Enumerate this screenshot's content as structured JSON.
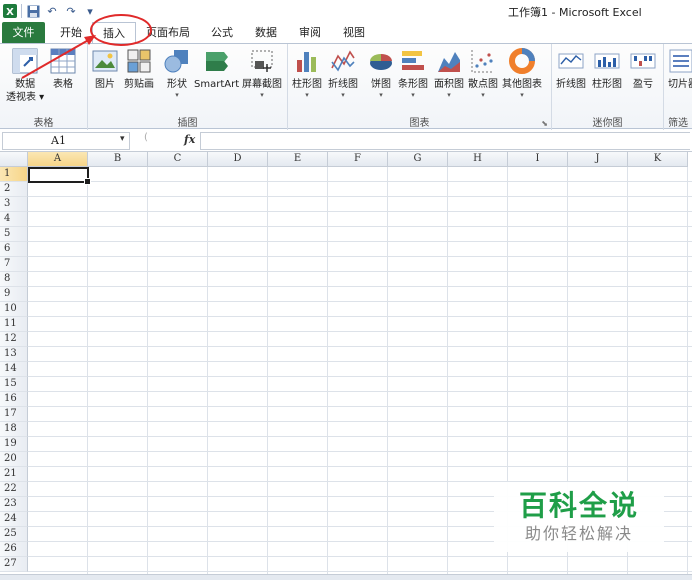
{
  "title_bar": {
    "app_title": "工作簿1 - Microsoft Excel",
    "qat": [
      "excel-logo-icon",
      "save-icon",
      "undo-icon",
      "redo-icon",
      "customize-qat-icon"
    ]
  },
  "tabs": [
    {
      "id": "file",
      "label": "文件"
    },
    {
      "id": "home",
      "label": "开始"
    },
    {
      "id": "insert",
      "label": "插入"
    },
    {
      "id": "layout",
      "label": "页面布局"
    },
    {
      "id": "formulas",
      "label": "公式"
    },
    {
      "id": "data",
      "label": "数据"
    },
    {
      "id": "review",
      "label": "审阅"
    },
    {
      "id": "view",
      "label": "视图"
    }
  ],
  "active_tab": "插入",
  "ribbon": {
    "groups": {
      "tables": {
        "label": "表格",
        "buttons": [
          {
            "label": "数据",
            "label2": "透视表 ▾"
          },
          {
            "label": "表格"
          }
        ]
      },
      "illustrations": {
        "label": "插图",
        "buttons": [
          {
            "label": "图片"
          },
          {
            "label": "剪贴画"
          },
          {
            "label": "形状"
          },
          {
            "label": "SmartArt"
          },
          {
            "label": "屏幕截图"
          }
        ]
      },
      "charts": {
        "label": "图表",
        "buttons": [
          {
            "label": "柱形图"
          },
          {
            "label": "折线图"
          },
          {
            "label": "饼图"
          },
          {
            "label": "条形图"
          },
          {
            "label": "面积图"
          },
          {
            "label": "散点图"
          },
          {
            "label": "其他图表"
          }
        ]
      },
      "sparklines": {
        "label": "迷你图",
        "buttons": [
          {
            "label": "折线图"
          },
          {
            "label": "柱形图"
          },
          {
            "label": "盈亏"
          }
        ]
      },
      "filter": {
        "label": "筛选",
        "buttons": [
          {
            "label": "切片器"
          }
        ]
      }
    },
    "dropdown_glyph": "▾",
    "launcher_glyph": "⬊"
  },
  "formula_bar": {
    "name_box": "A1",
    "fx_label": "fx",
    "formula": ""
  },
  "grid": {
    "columns": [
      "A",
      "B",
      "C",
      "D",
      "E",
      "F",
      "G",
      "H",
      "I",
      "J",
      "K"
    ],
    "rows": [
      "1",
      "2",
      "3",
      "4",
      "5",
      "6",
      "7",
      "8",
      "9",
      "10",
      "11",
      "12",
      "13",
      "14",
      "15",
      "16",
      "17",
      "18",
      "19",
      "20",
      "21",
      "22",
      "23",
      "24",
      "25",
      "26",
      "27"
    ],
    "active_cell": "A1"
  },
  "watermark": {
    "title": "百科全说",
    "subtitle": "助你轻松解决"
  },
  "colors": {
    "file_tab": "#2a7a3e",
    "annotation": "#e02a2a",
    "watermark_green": "#1f9e48",
    "selected_header": "#f6d588"
  }
}
